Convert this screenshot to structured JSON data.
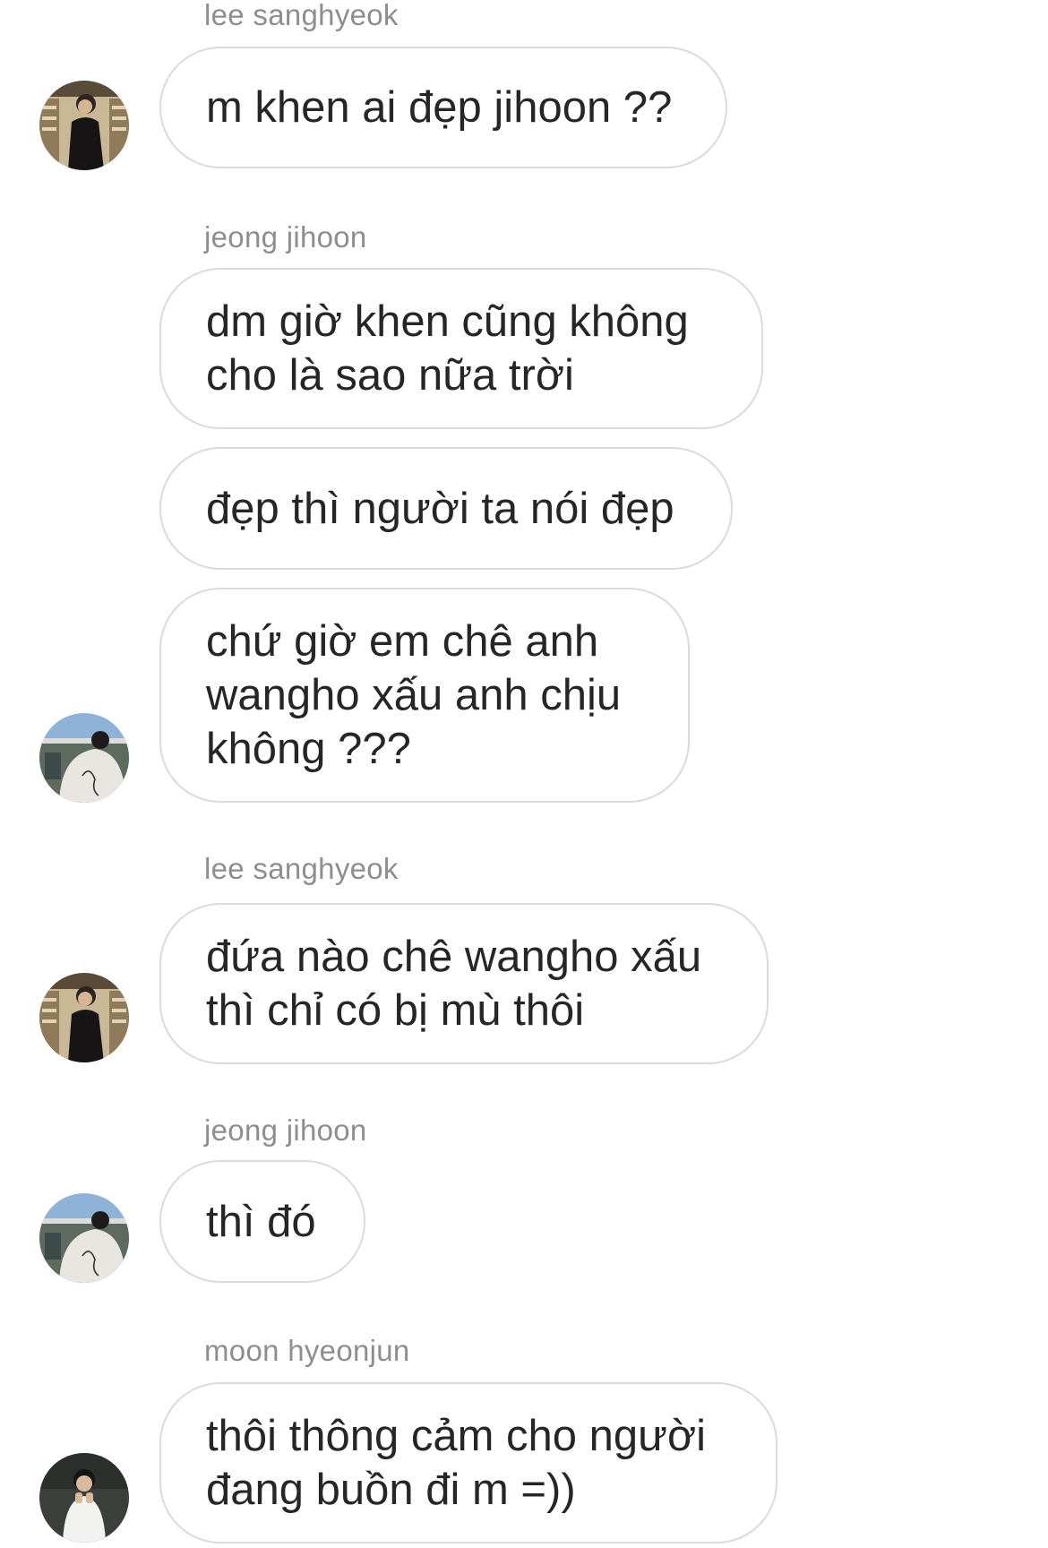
{
  "participants": {
    "faker": "lee sanghyeok",
    "chovy": "jeong jihoon",
    "oner": "moon hyeonjun"
  },
  "messages": [
    {
      "sender": "lee sanghyeok",
      "text": "m khen ai đẹp jihoon ??"
    },
    {
      "sender": "jeong jihoon",
      "text": "dm giờ khen cũng không\ncho là sao nữa trời"
    },
    {
      "sender": "jeong jihoon",
      "text": "đẹp thì người ta nói đẹp"
    },
    {
      "sender": "jeong jihoon",
      "text": "chứ giờ em chê anh\nwangho xấu anh chịu\nkhông ???"
    },
    {
      "sender": "lee sanghyeok",
      "text": "đứa nào chê wangho xấu\nthì chỉ có bị mù thôi"
    },
    {
      "sender": "jeong jihoon",
      "text": "thì đó"
    },
    {
      "sender": "moon hyeonjun",
      "text": "thôi thông cảm cho người\nđang buồn đi m =))"
    }
  ],
  "avatars": {
    "faker": "avatar-photo-man-black-coat-library",
    "chovy": "avatar-photo-white-hoodie-back",
    "oner": "avatar-photo-man-white-shirt"
  },
  "colors": {
    "background": "#ffffff",
    "bubble_border": "#dbdbdb",
    "message_text": "#262626",
    "sender_text": "#8e8e8e"
  }
}
